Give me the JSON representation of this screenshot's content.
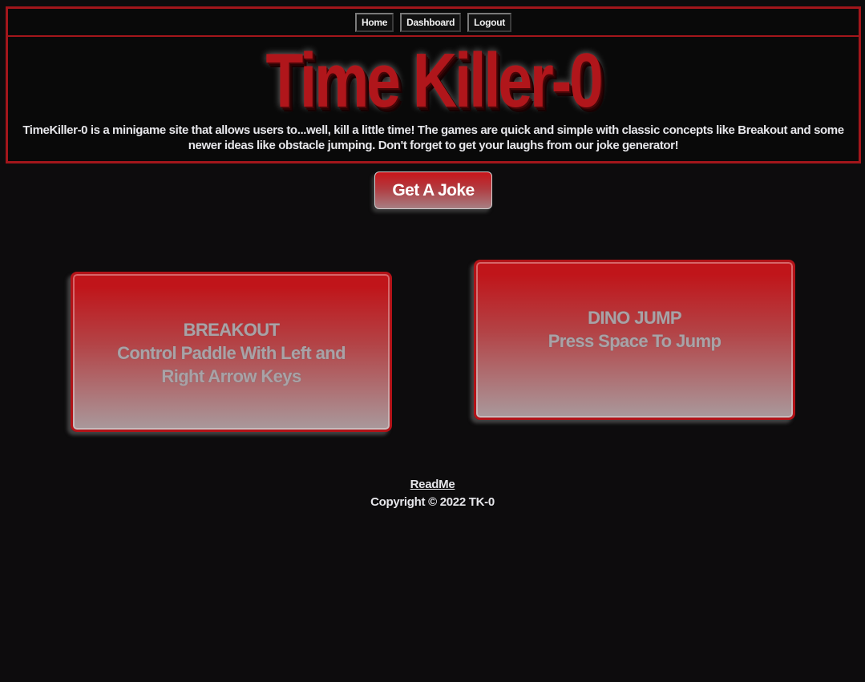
{
  "nav": {
    "home": "Home",
    "dashboard": "Dashboard",
    "logout": "Logout"
  },
  "header": {
    "title": "Time Killer-0",
    "tagline": "TimeKiller-0 is a minigame site that allows users to...well, kill a little time! The games are quick and simple with classic concepts like Breakout and some newer ideas like obstacle jumping. Don't forget to get your laughs from our joke generator!"
  },
  "joke_button": "Get A Joke",
  "games": [
    {
      "title": "BREAKOUT",
      "description": "Control Paddle With Left and Right Arrow Keys"
    },
    {
      "title": "DINO JUMP",
      "description": "Press Space To Jump"
    }
  ],
  "footer": {
    "readme": "ReadMe",
    "copyright": "Copyright © 2022 TK-0"
  },
  "colors": {
    "background": "#0d0c0d",
    "accent_red": "#a3161b",
    "text_light": "#e6e6ea"
  }
}
